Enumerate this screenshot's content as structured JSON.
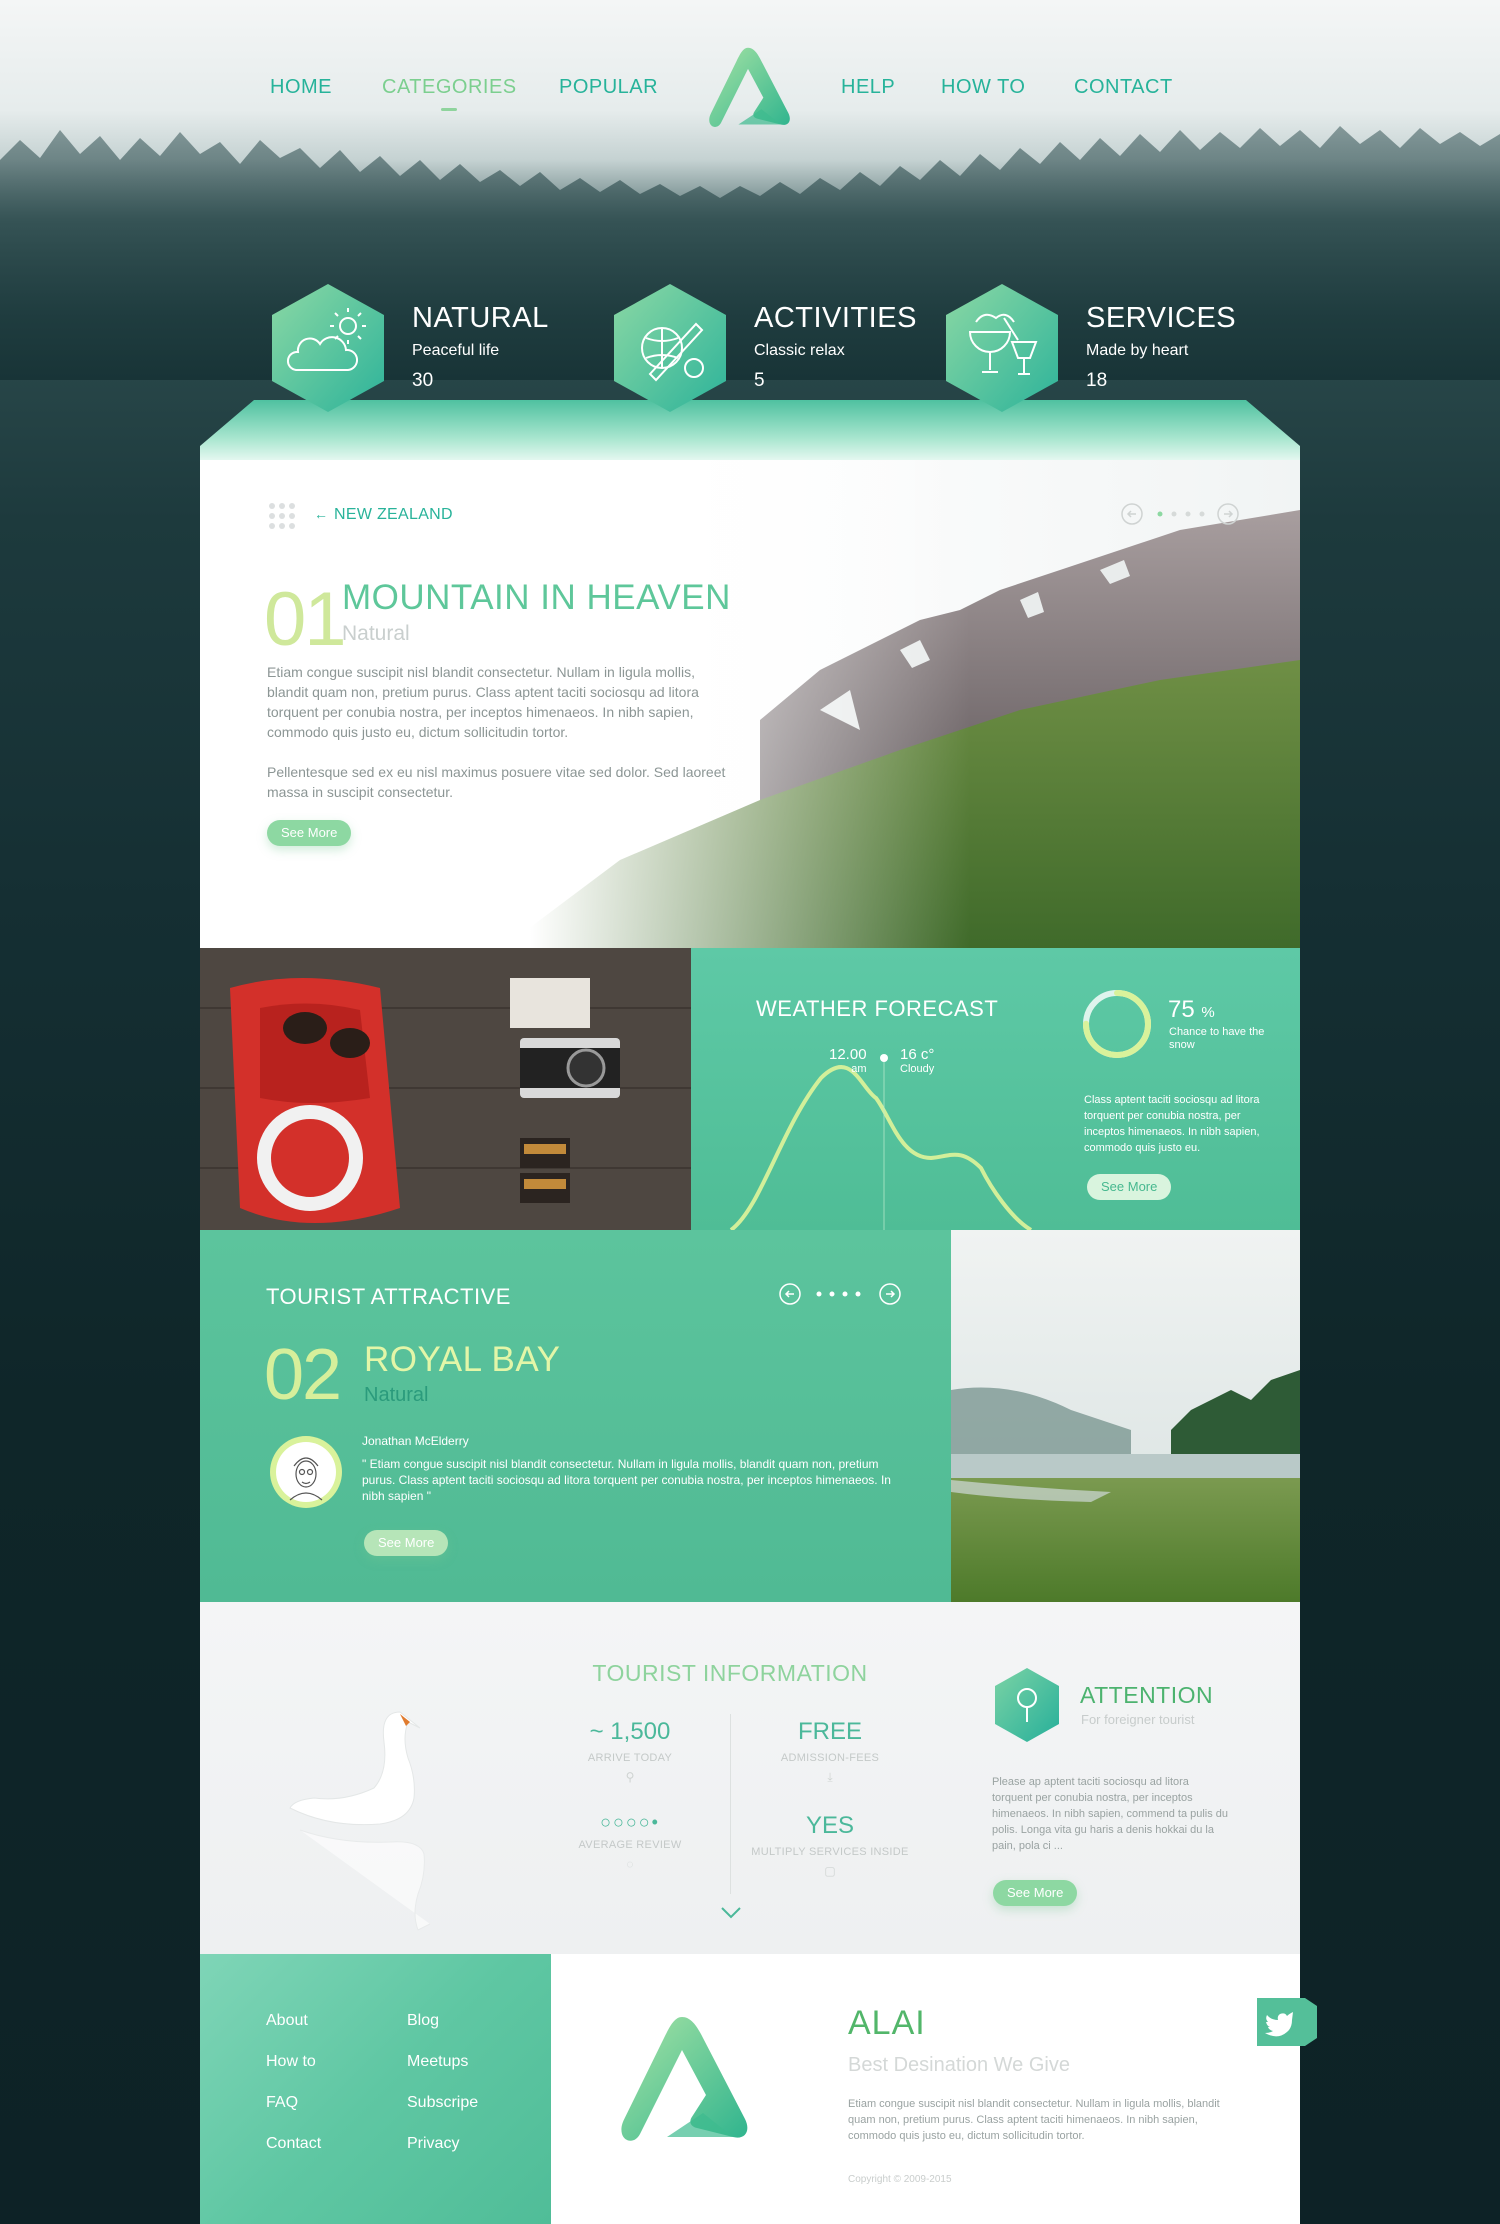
{
  "nav": {
    "left": [
      "HOME",
      "CATEGORIES",
      "POPULAR"
    ],
    "right": [
      "HELP",
      "HOW TO",
      "CONTACT"
    ],
    "active": "CATEGORIES"
  },
  "categories": [
    {
      "title": "NATURAL",
      "subtitle": "Peaceful life",
      "count": "30",
      "icon": "weather-cloud-sun-icon"
    },
    {
      "title": "ACTIVITIES",
      "subtitle": "Classic relax",
      "count": "5",
      "icon": "sports-bat-ball-icon"
    },
    {
      "title": "SERVICES",
      "subtitle": "Made by heart",
      "count": "18",
      "icon": "cocktail-drink-icon"
    }
  ],
  "hero": {
    "breadcrumb": "NEW ZEALAND",
    "number": "01",
    "title": "MOUNTAIN IN HEAVEN",
    "category": "Natural",
    "paragraph1": "Etiam congue suscipit nisl blandit consectetur. Nullam in ligula mollis, blandit quam non, pretium purus. Class aptent taciti sociosqu ad litora torquent per conubia nostra, per inceptos himenaeos. In nibh sapien, commodo quis justo eu, dictum sollicitudin tortor.",
    "paragraph2": "Pellentesque sed ex eu nisl maximus posuere vitae sed dolor. Sed laoreet massa in suscipit consectetur.",
    "button": "See More"
  },
  "weather": {
    "title": "WEATHER FORECAST",
    "time": "12.00",
    "time_suffix": "am",
    "temp": "16 c°",
    "condition": "Cloudy",
    "percent": "75",
    "percent_unit": "%",
    "percent_label": "Chance to have the snow",
    "snow_chance_fraction": 0.75,
    "text": "Class aptent taciti sociosqu ad litora torquent per conubia nostra, per inceptos himenaeos. In nibh sapien, commodo quis justo eu.",
    "button": "See More"
  },
  "attractive": {
    "title": "TOURIST ATTRACTIVE",
    "number": "02",
    "name": "ROYAL BAY",
    "category": "Natural",
    "author": "Jonathan McElderry",
    "quote": "\" Etiam congue suscipit nisl blandit consectetur. Nullam in ligula mollis, blandit quam non, pretium purus. Class aptent taciti sociosqu ad litora torquent per conubia nostra, per inceptos himenaeos. In nibh sapien \"",
    "button": "See More"
  },
  "info": {
    "title": "TOURIST INFORMATION",
    "stats": [
      {
        "value": "~ 1,500",
        "label": "ARRIVE TODAY",
        "icon": "person-icon"
      },
      {
        "value": "FREE",
        "label": "ADMISSION-FEES",
        "icon": "download-icon"
      },
      {
        "value": "○○○○•",
        "label": "AVERAGE REVIEW",
        "icon": "chat-icon"
      },
      {
        "value": "YES",
        "label": "MULTIPLY SERVICES INSIDE",
        "icon": "bag-icon"
      }
    ],
    "attention_title": "ATTENTION",
    "attention_sub": "For foreigner tourist",
    "attention_text": "Please ap aptent taciti sociosqu ad litora torquent per conubia nostra, per inceptos himenaeos. In nibh sapien, commend ta pulis du polis. Longa vita gu haris a denis hokkai du la pain, pola ci ...",
    "button": "See More"
  },
  "footer": {
    "links_col1": [
      "About",
      "How to",
      "FAQ",
      "Contact"
    ],
    "links_col2": [
      "Blog",
      "Meetups",
      "Subscripe",
      "Privacy"
    ],
    "brand": "ALAI",
    "tagline": "Best Desination We Give",
    "text": "Etiam congue suscipit nisl blandit consectetur. Nullam in ligula mollis, blandit quam non, pretium purus. Class aptent taciti himenaeos. In nibh sapien, commodo quis justo eu, dictum sollicitudin tortor.",
    "copyright": "Copyright © 2009-2015"
  },
  "colors": {
    "accent": "#27b39a",
    "green": "#5ec79a",
    "lime": "#d6ef9b"
  }
}
